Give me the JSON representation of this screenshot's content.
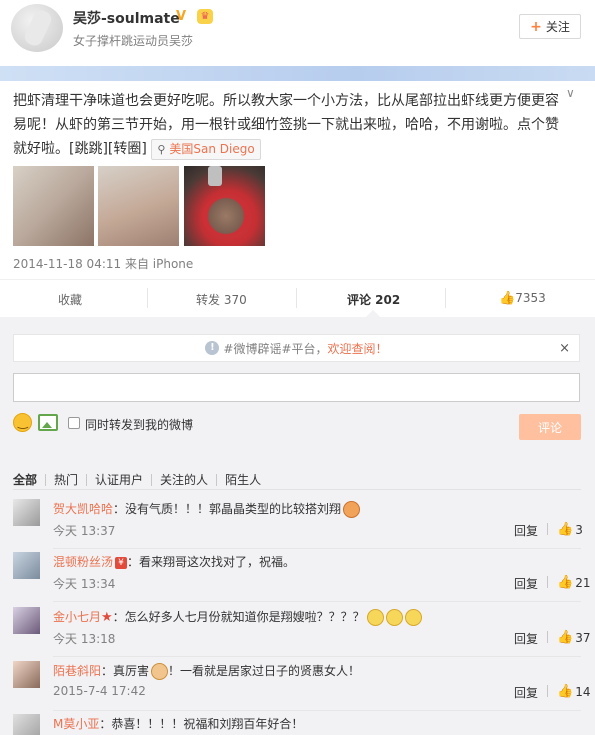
{
  "profile": {
    "name": "吴莎-soulmate",
    "verified_mark": "V",
    "description": "女子撑杆跳运动员吴莎",
    "follow_label": "关注",
    "follow_plus": "+"
  },
  "post": {
    "text": "把虾清理干净味道也会更好吃呢。所以教大家一个小方法，比从尾部拉出虾线更方便更容易呢！从虾的第三节开始，用一根针或细竹签挑一下就出来啦，哈哈，不用谢啦。点个赞就好啦。[跳跳][转圈]",
    "location": "美国San Diego",
    "time": "2014-11-18 04:11",
    "source": "来自 iPhone"
  },
  "actions": {
    "favorite": "收藏",
    "repost": "转发 370",
    "comment": "评论 202",
    "like": "7353"
  },
  "comment_box": {
    "notice_prefix": "#微博辟谣#平台，",
    "notice_link": "欢迎查阅！",
    "close_glyph": "×",
    "repost_option": "同时转发到我的微博",
    "submit_label": "评论"
  },
  "filters": [
    "全部",
    "热门",
    "认证用户",
    "关注的人",
    "陌生人"
  ],
  "comments": [
    {
      "name": "贺大凯哈哈",
      "text": "：没有气质！！！郭晶晶类型的比较搭刘翔",
      "time": "今天 13:37",
      "reply": "回复",
      "likes": "3"
    },
    {
      "name": "混顿粉丝汤",
      "text": "：看来翔哥这次找对了，祝福。",
      "time": "今天 13:34",
      "reply": "回复",
      "likes": "21"
    },
    {
      "name": "金小七月",
      "text": "：怎么好多人七月份就知道你是翔嫂啦？？？？",
      "time": "今天 13:18",
      "reply": "回复",
      "likes": "37"
    },
    {
      "name": "陌巷斜阳",
      "text_a": "：真厉害",
      "text_b": "！一看就是居家过日子的贤惠女人！",
      "time": "2015-7-4 17:42",
      "reply": "回复",
      "likes": "14"
    },
    {
      "name": "M莫小亚",
      "text": "：恭喜！！！！祝福和刘翔百年好合！"
    }
  ]
}
